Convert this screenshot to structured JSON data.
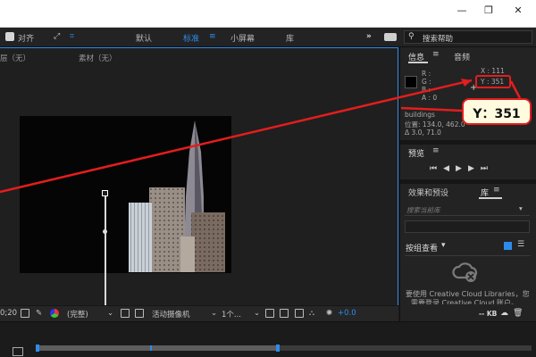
{
  "toolbar": {
    "align_label": "对齐",
    "workspaces": [
      "默认",
      "标准",
      "小屏幕",
      "库"
    ],
    "active_workspace": "标准",
    "search_placeholder": "搜索帮助",
    "more_glyph": "»"
  },
  "comp_panel": {
    "layer_label": "层（无）",
    "footage_label": "素材（无）",
    "bottom": {
      "time": "0;20",
      "resolution": "(完整)",
      "camera": "活动摄像机",
      "views": "1个...",
      "exposure": "+0.0"
    }
  },
  "right_panel": {
    "info_tab": "信息",
    "audio_tab": "音频",
    "rgb": [
      "R :",
      "G :",
      "B :",
      "A : 0"
    ],
    "x_readout": "X : 111",
    "y_readout": "Y : 351",
    "layer_name": "buildings",
    "position": "位置: 134.0, 462.0",
    "delta": "Δ 3.0, 71.0",
    "preview_tab": "预览",
    "effects_tab": "效果和预设",
    "library_tab": "库",
    "search_libraries": "搜索当前库",
    "group_view": "按组查看",
    "cc_message_1": "要使用 Creative Cloud Libraries，您",
    "cc_message_2": "需要登录 Creative Cloud 账户。",
    "kb_label": "-- KB"
  },
  "callout": {
    "text": "Y：351"
  },
  "colors": {
    "accent": "#2d8ceb",
    "annotation_red": "#e41d1d",
    "callout_bg": "#fffbdf"
  }
}
